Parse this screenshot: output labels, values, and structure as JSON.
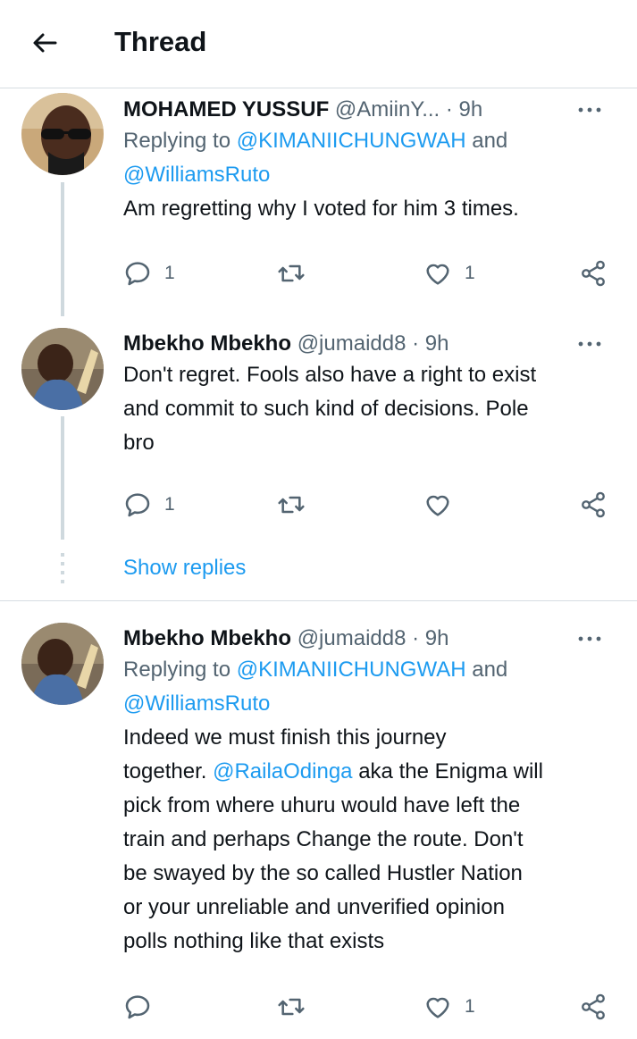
{
  "header": {
    "title": "Thread"
  },
  "tweets": [
    {
      "name": "MOHAMED YUSSUF",
      "handle": "@AmiinY...",
      "time": "· 9h",
      "replying_prefix": "Replying to ",
      "replying_user1": "@KIMANIICHUNGWAH",
      "replying_and": " and",
      "replying_user2": "@WilliamsRuto",
      "text": "Am regretting why I voted for him 3 times.",
      "reply_count": "1",
      "retweet_count": "",
      "like_count": "1"
    },
    {
      "name": "Mbekho Mbekho",
      "handle": "@jumaidd8",
      "time": "· 9h",
      "text_line1": "Don't regret. Fools also have a right to exist",
      "text_line2": "and commit to such kind of decisions. Pole",
      "text_line3": "bro",
      "reply_count": "1",
      "retweet_count": "",
      "like_count": ""
    },
    {
      "name": "Mbekho Mbekho",
      "handle": "@jumaidd8",
      "time": "· 9h",
      "replying_prefix": "Replying to ",
      "replying_user1": "@KIMANIICHUNGWAH",
      "replying_and": " and",
      "replying_user2": "@WilliamsRuto",
      "line1": "Indeed we must finish this journey",
      "line2_pre": "together. ",
      "line2_mention": "@RailaOdinga",
      "line2_post": " aka the Enigma will",
      "line3": "pick from where uhuru would have left the",
      "line4": "train and perhaps Change the route. Don't",
      "line5": "be swayed by the so called Hustler Nation",
      "line6": "or your unreliable and unverified opinion",
      "line7": "polls nothing like that exists",
      "reply_count": "",
      "retweet_count": "",
      "like_count": "1"
    }
  ],
  "show_replies": "Show replies",
  "colors": {
    "accent": "#1d9bf0",
    "secondary_text": "#536471",
    "divider": "#d6dde2"
  }
}
